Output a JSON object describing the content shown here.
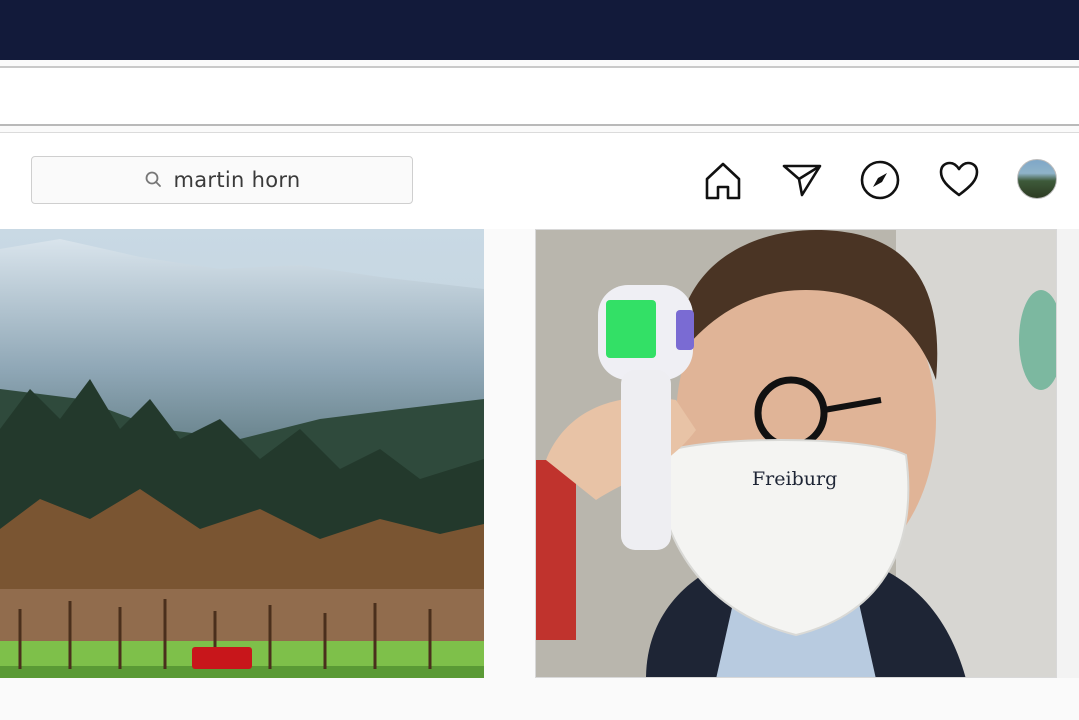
{
  "search": {
    "query": "martin horn",
    "icon": "search-icon"
  },
  "nav": {
    "icons": [
      "home-icon",
      "direct-send-icon",
      "explore-compass-icon",
      "activity-heart-icon",
      "profile-avatar"
    ]
  },
  "posts": [
    {
      "subject": "snowy forest hill with autumn trees and red tractor"
    },
    {
      "subject": "man with glasses and face mask getting temperature measured",
      "mask_logo": "Freiburg"
    }
  ],
  "colors": {
    "topbar": "#121a3a",
    "background": "#fafafa",
    "border": "#dbdbdb"
  }
}
